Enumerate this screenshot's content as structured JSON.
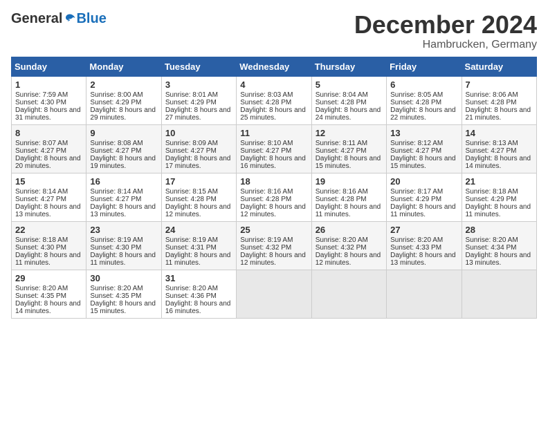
{
  "header": {
    "logo_general": "General",
    "logo_blue": "Blue",
    "month_title": "December 2024",
    "location": "Hambrucken, Germany"
  },
  "days_of_week": [
    "Sunday",
    "Monday",
    "Tuesday",
    "Wednesday",
    "Thursday",
    "Friday",
    "Saturday"
  ],
  "weeks": [
    [
      {
        "day": "1",
        "sunrise": "Sunrise: 7:59 AM",
        "sunset": "Sunset: 4:30 PM",
        "daylight": "Daylight: 8 hours and 31 minutes."
      },
      {
        "day": "2",
        "sunrise": "Sunrise: 8:00 AM",
        "sunset": "Sunset: 4:29 PM",
        "daylight": "Daylight: 8 hours and 29 minutes."
      },
      {
        "day": "3",
        "sunrise": "Sunrise: 8:01 AM",
        "sunset": "Sunset: 4:29 PM",
        "daylight": "Daylight: 8 hours and 27 minutes."
      },
      {
        "day": "4",
        "sunrise": "Sunrise: 8:03 AM",
        "sunset": "Sunset: 4:28 PM",
        "daylight": "Daylight: 8 hours and 25 minutes."
      },
      {
        "day": "5",
        "sunrise": "Sunrise: 8:04 AM",
        "sunset": "Sunset: 4:28 PM",
        "daylight": "Daylight: 8 hours and 24 minutes."
      },
      {
        "day": "6",
        "sunrise": "Sunrise: 8:05 AM",
        "sunset": "Sunset: 4:28 PM",
        "daylight": "Daylight: 8 hours and 22 minutes."
      },
      {
        "day": "7",
        "sunrise": "Sunrise: 8:06 AM",
        "sunset": "Sunset: 4:28 PM",
        "daylight": "Daylight: 8 hours and 21 minutes."
      }
    ],
    [
      {
        "day": "8",
        "sunrise": "Sunrise: 8:07 AM",
        "sunset": "Sunset: 4:27 PM",
        "daylight": "Daylight: 8 hours and 20 minutes."
      },
      {
        "day": "9",
        "sunrise": "Sunrise: 8:08 AM",
        "sunset": "Sunset: 4:27 PM",
        "daylight": "Daylight: 8 hours and 19 minutes."
      },
      {
        "day": "10",
        "sunrise": "Sunrise: 8:09 AM",
        "sunset": "Sunset: 4:27 PM",
        "daylight": "Daylight: 8 hours and 17 minutes."
      },
      {
        "day": "11",
        "sunrise": "Sunrise: 8:10 AM",
        "sunset": "Sunset: 4:27 PM",
        "daylight": "Daylight: 8 hours and 16 minutes."
      },
      {
        "day": "12",
        "sunrise": "Sunrise: 8:11 AM",
        "sunset": "Sunset: 4:27 PM",
        "daylight": "Daylight: 8 hours and 15 minutes."
      },
      {
        "day": "13",
        "sunrise": "Sunrise: 8:12 AM",
        "sunset": "Sunset: 4:27 PM",
        "daylight": "Daylight: 8 hours and 15 minutes."
      },
      {
        "day": "14",
        "sunrise": "Sunrise: 8:13 AM",
        "sunset": "Sunset: 4:27 PM",
        "daylight": "Daylight: 8 hours and 14 minutes."
      }
    ],
    [
      {
        "day": "15",
        "sunrise": "Sunrise: 8:14 AM",
        "sunset": "Sunset: 4:27 PM",
        "daylight": "Daylight: 8 hours and 13 minutes."
      },
      {
        "day": "16",
        "sunrise": "Sunrise: 8:14 AM",
        "sunset": "Sunset: 4:27 PM",
        "daylight": "Daylight: 8 hours and 13 minutes."
      },
      {
        "day": "17",
        "sunrise": "Sunrise: 8:15 AM",
        "sunset": "Sunset: 4:28 PM",
        "daylight": "Daylight: 8 hours and 12 minutes."
      },
      {
        "day": "18",
        "sunrise": "Sunrise: 8:16 AM",
        "sunset": "Sunset: 4:28 PM",
        "daylight": "Daylight: 8 hours and 12 minutes."
      },
      {
        "day": "19",
        "sunrise": "Sunrise: 8:16 AM",
        "sunset": "Sunset: 4:28 PM",
        "daylight": "Daylight: 8 hours and 11 minutes."
      },
      {
        "day": "20",
        "sunrise": "Sunrise: 8:17 AM",
        "sunset": "Sunset: 4:29 PM",
        "daylight": "Daylight: 8 hours and 11 minutes."
      },
      {
        "day": "21",
        "sunrise": "Sunrise: 8:18 AM",
        "sunset": "Sunset: 4:29 PM",
        "daylight": "Daylight: 8 hours and 11 minutes."
      }
    ],
    [
      {
        "day": "22",
        "sunrise": "Sunrise: 8:18 AM",
        "sunset": "Sunset: 4:30 PM",
        "daylight": "Daylight: 8 hours and 11 minutes."
      },
      {
        "day": "23",
        "sunrise": "Sunrise: 8:19 AM",
        "sunset": "Sunset: 4:30 PM",
        "daylight": "Daylight: 8 hours and 11 minutes."
      },
      {
        "day": "24",
        "sunrise": "Sunrise: 8:19 AM",
        "sunset": "Sunset: 4:31 PM",
        "daylight": "Daylight: 8 hours and 11 minutes."
      },
      {
        "day": "25",
        "sunrise": "Sunrise: 8:19 AM",
        "sunset": "Sunset: 4:32 PM",
        "daylight": "Daylight: 8 hours and 12 minutes."
      },
      {
        "day": "26",
        "sunrise": "Sunrise: 8:20 AM",
        "sunset": "Sunset: 4:32 PM",
        "daylight": "Daylight: 8 hours and 12 minutes."
      },
      {
        "day": "27",
        "sunrise": "Sunrise: 8:20 AM",
        "sunset": "Sunset: 4:33 PM",
        "daylight": "Daylight: 8 hours and 13 minutes."
      },
      {
        "day": "28",
        "sunrise": "Sunrise: 8:20 AM",
        "sunset": "Sunset: 4:34 PM",
        "daylight": "Daylight: 8 hours and 13 minutes."
      }
    ],
    [
      {
        "day": "29",
        "sunrise": "Sunrise: 8:20 AM",
        "sunset": "Sunset: 4:35 PM",
        "daylight": "Daylight: 8 hours and 14 minutes."
      },
      {
        "day": "30",
        "sunrise": "Sunrise: 8:20 AM",
        "sunset": "Sunset: 4:35 PM",
        "daylight": "Daylight: 8 hours and 15 minutes."
      },
      {
        "day": "31",
        "sunrise": "Sunrise: 8:20 AM",
        "sunset": "Sunset: 4:36 PM",
        "daylight": "Daylight: 8 hours and 16 minutes."
      },
      null,
      null,
      null,
      null
    ]
  ]
}
